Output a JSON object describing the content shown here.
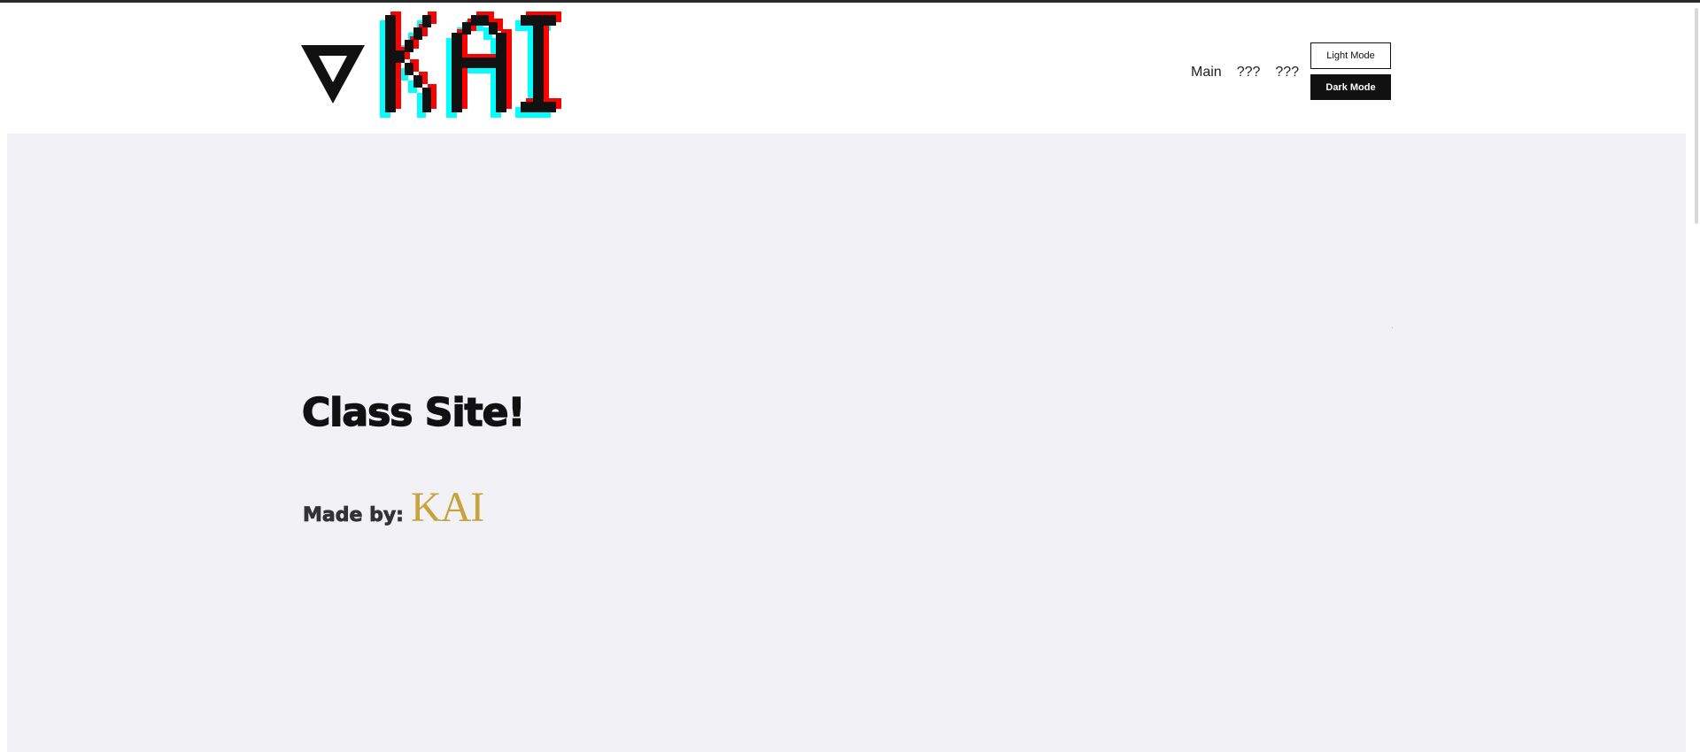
{
  "header": {
    "logo_text": "KAI",
    "logo_icon": "triangle-logo-icon",
    "nav": [
      {
        "label": "Main"
      },
      {
        "label": "???"
      },
      {
        "label": "???"
      }
    ],
    "light_mode_label": "Light Mode",
    "dark_mode_label": "Dark Mode"
  },
  "main": {
    "title": "Class Site!",
    "made_by_label": "Made by:",
    "made_by_name": "KAI"
  },
  "colors": {
    "logo_red": "#ff0000",
    "logo_cyan": "#00ffff",
    "logo_black": "#111111",
    "main_bg": "#f2f1f6",
    "name_gold": "#c9a23a"
  }
}
